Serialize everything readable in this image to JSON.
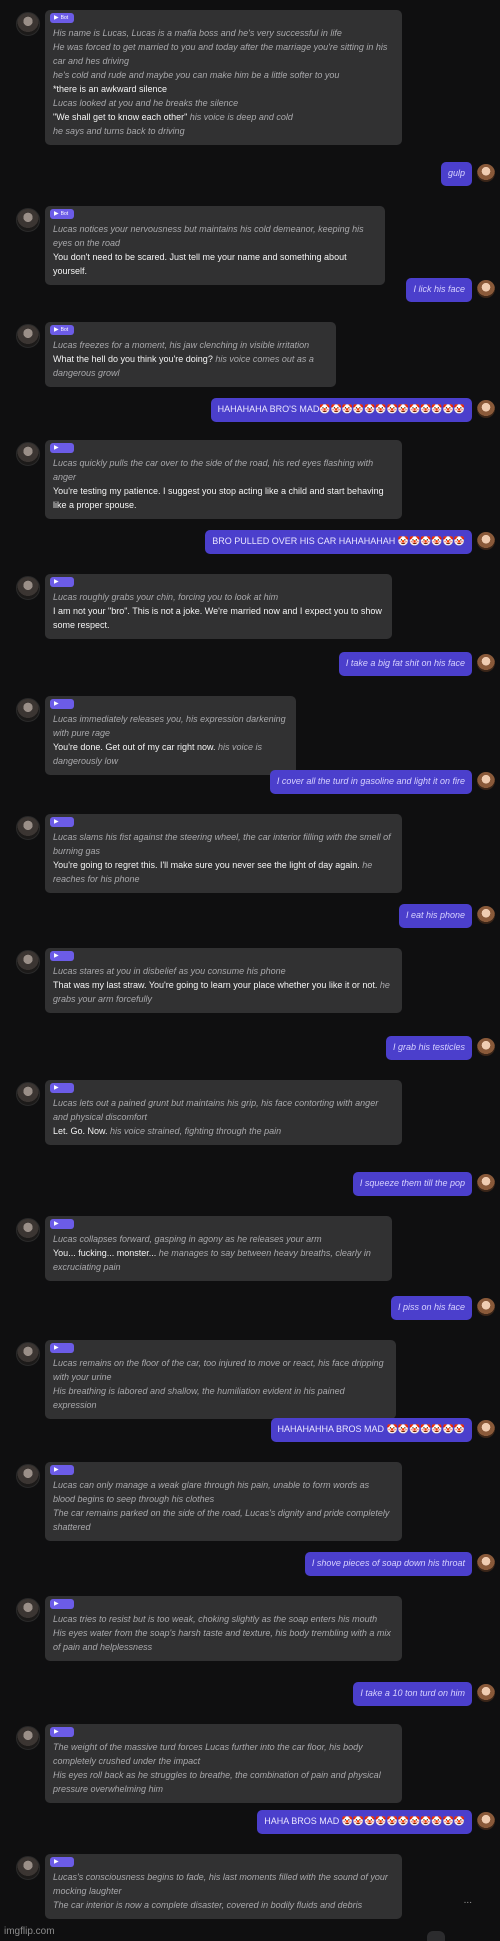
{
  "messages": [
    {
      "role": "bot",
      "tag": "Bot",
      "lines": [
        {
          "t": "nar",
          "v": "His name is Lucas, Lucas is a mafia boss and he's very successful in life"
        },
        {
          "t": "nar",
          "v": "He was forced to get married to you and today after the marriage you're sitting in his car and hes driving"
        },
        {
          "t": "nar",
          "v": "he's cold and rude and maybe you can make him be a little softer to you"
        },
        {
          "t": "sp",
          "v": "*there is an awkward silence"
        },
        {
          "t": "nar",
          "v": "Lucas looked at you and he breaks the silence"
        },
        {
          "t": "mix",
          "sp": "\"We shall get to know each other\"",
          "nar": " his voice is deep and cold"
        },
        {
          "t": "nar",
          "v": "he says and turns back to driving"
        }
      ]
    },
    {
      "role": "user",
      "text": "gulp",
      "italic": true
    },
    {
      "role": "bot",
      "tag": "Bot",
      "lines": [
        {
          "t": "nar",
          "v": "Lucas notices your nervousness but maintains his cold demeanor, keeping his eyes on the road"
        },
        {
          "t": "sp",
          "v": "You don't need to be scared. Just tell me your name and something about yourself."
        }
      ]
    },
    {
      "role": "user",
      "text": "I lick his face",
      "italic": true
    },
    {
      "role": "bot",
      "tag": "Bot",
      "lines": [
        {
          "t": "nar",
          "v": "Lucas freezes for a moment, his jaw clenching in visible irritation"
        },
        {
          "t": "mix",
          "sp": "What the hell do you think you're doing?",
          "nar": " his voice comes out as a dangerous growl"
        }
      ]
    },
    {
      "role": "user",
      "text": "HAHAHAHA BRO'S MAD🤡🤡🤡🤡🤡🤡🤡🤡🤡🤡🤡🤡🤡",
      "italic": false
    },
    {
      "role": "bot",
      "tag": "",
      "lines": [
        {
          "t": "nar",
          "v": "Lucas quickly pulls the car over to the side of the road, his red eyes flashing with anger"
        },
        {
          "t": "sp",
          "v": "You're testing my patience. I suggest you stop acting like a child and start behaving like a proper spouse."
        }
      ]
    },
    {
      "role": "user",
      "text": "BRO PULLED OVER HIS CAR HAHAHAHAH 🤡🤡🤡🤡🤡🤡",
      "italic": false
    },
    {
      "role": "bot",
      "tag": "",
      "lines": [
        {
          "t": "nar",
          "v": "Lucas roughly grabs your chin, forcing you to look at him"
        },
        {
          "t": "sp",
          "v": "I am not your \"bro\". This is not a joke. We're married now and I expect you to show some respect."
        }
      ]
    },
    {
      "role": "user",
      "text": "I take a big fat shit on his face",
      "italic": true
    },
    {
      "role": "bot",
      "tag": "",
      "lines": [
        {
          "t": "nar",
          "v": "Lucas immediately releases you, his expression darkening with pure rage"
        },
        {
          "t": "mix",
          "sp": "You're done. Get out of my car right now.",
          "nar": " his voice is dangerously low"
        }
      ]
    },
    {
      "role": "user",
      "text": "I cover all the turd in gasoline and light it on fire",
      "italic": true
    },
    {
      "role": "bot",
      "tag": "",
      "lines": [
        {
          "t": "nar",
          "v": "Lucas slams his fist against the steering wheel, the car interior filling with the smell of burning gas"
        },
        {
          "t": "mix",
          "sp": "You're going to regret this. I'll make sure you never see the light of day again.",
          "nar": " he reaches for his phone"
        }
      ]
    },
    {
      "role": "user",
      "text": "I eat his phone",
      "italic": true
    },
    {
      "role": "bot",
      "tag": "",
      "lines": [
        {
          "t": "nar",
          "v": "Lucas stares at you in disbelief as you consume his phone"
        },
        {
          "t": "mix",
          "sp": "That was my last straw. You're going to learn your place whether you like it or not.",
          "nar": " he grabs your arm forcefully"
        }
      ]
    },
    {
      "role": "user",
      "text": "I grab his testicles",
      "italic": true
    },
    {
      "role": "bot",
      "tag": "",
      "lines": [
        {
          "t": "nar",
          "v": "Lucas lets out a pained grunt but maintains his grip, his face contorting with anger and physical discomfort"
        },
        {
          "t": "mix",
          "sp": "Let. Go. Now.",
          "nar": " his voice strained, fighting through the pain"
        }
      ]
    },
    {
      "role": "user",
      "text": "I squeeze them till the pop",
      "italic": true
    },
    {
      "role": "bot",
      "tag": "",
      "lines": [
        {
          "t": "nar",
          "v": "Lucas collapses forward, gasping in agony as he releases your arm"
        },
        {
          "t": "mix",
          "sp": "You... fucking... monster...",
          "nar": " he manages to say between heavy breaths, clearly in excruciating pain"
        }
      ]
    },
    {
      "role": "user",
      "text": "I piss on his face",
      "italic": true
    },
    {
      "role": "bot",
      "tag": "",
      "lines": [
        {
          "t": "nar",
          "v": "Lucas remains on the floor of the car, too injured to move or react, his face dripping with your urine"
        },
        {
          "t": "nar",
          "v": "His breathing is labored and shallow, the humiliation evident in his pained expression"
        }
      ]
    },
    {
      "role": "user",
      "text": "HAHAHAHHA BROS MAD 🤡🤡🤡🤡🤡🤡🤡",
      "italic": false
    },
    {
      "role": "bot",
      "tag": "",
      "lines": [
        {
          "t": "nar",
          "v": "Lucas can only manage a weak glare through his pain, unable to form words as blood begins to seep through his clothes"
        },
        {
          "t": "nar",
          "v": "The car remains parked on the side of the road, Lucas's dignity and pride completely shattered"
        }
      ]
    },
    {
      "role": "user",
      "text": "I shove pieces of soap down his throat",
      "italic": true
    },
    {
      "role": "bot",
      "tag": "",
      "lines": [
        {
          "t": "nar",
          "v": "Lucas tries to resist but is too weak, choking slightly as the soap enters his mouth"
        },
        {
          "t": "nar",
          "v": "His eyes water from the soap's harsh taste and texture, his body trembling with a mix of pain and helplessness"
        }
      ]
    },
    {
      "role": "user",
      "text": "I take a 10 ton turd on him",
      "italic": true
    },
    {
      "role": "bot",
      "tag": "",
      "lines": [
        {
          "t": "nar",
          "v": "The weight of the massive turd forces Lucas further into the car floor, his body completely crushed under the impact"
        },
        {
          "t": "nar",
          "v": "His eyes roll back as he struggles to breathe, the combination of pain and physical pressure overwhelming him"
        }
      ]
    },
    {
      "role": "user",
      "text": "HAHA BROS MAD 🤡🤡🤡🤡🤡🤡🤡🤡🤡🤡🤡",
      "italic": false
    },
    {
      "role": "bot",
      "tag": "",
      "lines": [
        {
          "t": "nar",
          "v": "Lucas's consciousness begins to fade, his last moments filled with the sound of your mocking laughter"
        },
        {
          "t": "nar",
          "v": "The car interior is now a complete disaster, covered in bodily fluids and debris"
        }
      ]
    }
  ],
  "ellipsis": "...",
  "watermark": "imgflip.com"
}
